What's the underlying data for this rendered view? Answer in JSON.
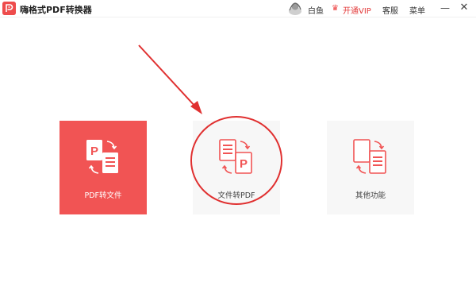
{
  "titlebar": {
    "title": "嗨格式PDF转换器",
    "username": "白鱼",
    "vip_label": "开通VIP",
    "service_label": "客服",
    "menu_label": "菜单",
    "minimize_glyph": "—",
    "close_glyph": "✕"
  },
  "cards": [
    {
      "label": "PDF转文件",
      "icon": "pdf-to-file-icon",
      "active": true
    },
    {
      "label": "文件转PDF",
      "icon": "file-to-pdf-icon",
      "active": false
    },
    {
      "label": "其他功能",
      "icon": "other-functions-icon",
      "active": false
    }
  ],
  "colors": {
    "accent": "#f15454",
    "highlight": "#e03030",
    "card_bg": "#f7f7f7"
  }
}
